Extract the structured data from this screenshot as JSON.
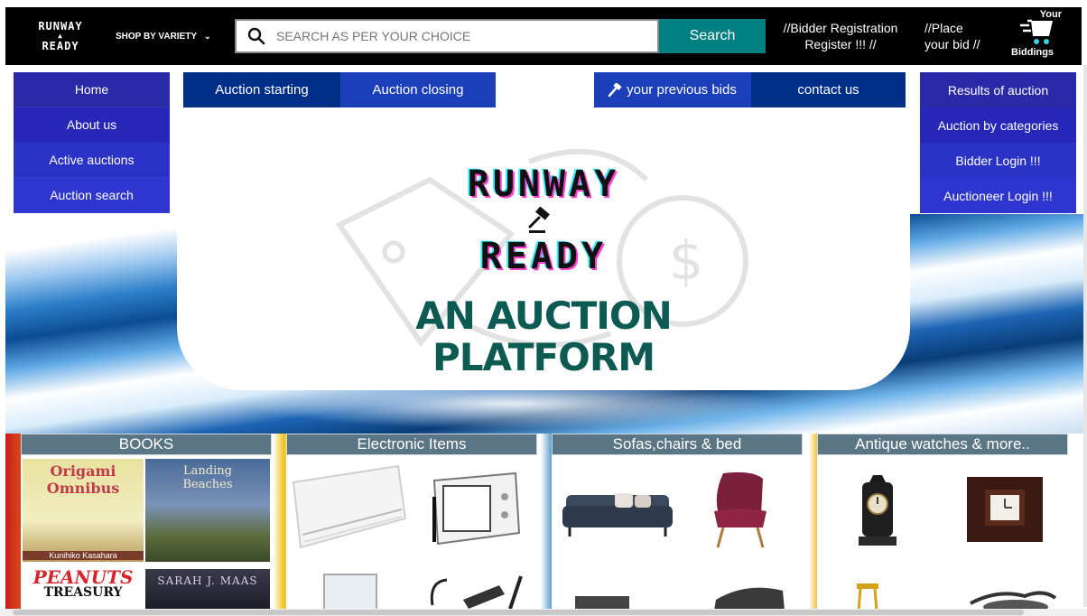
{
  "colors": {
    "topbar_bg": "#000000",
    "search_btn": "#008080",
    "nav_tab_dark": "#002f8a",
    "nav_tab_mid": "#1a3fb8",
    "menu_shades": [
      "#2a2aa8",
      "#2626b8",
      "#2a33c5",
      "#2e36cf"
    ],
    "hero_tagline": "#0c5a52",
    "cat_header": "#5a7584"
  },
  "header": {
    "logo_line1": "RUNWAY",
    "logo_line2": "READY",
    "shop_label": "SHOP BY VARIETY",
    "search_placeholder": "SEARCH AS PER YOUR CHOICE",
    "search_button": "Search",
    "bidder_registration_line1": "//Bidder Registration",
    "bidder_registration_line2": "Register !!! //",
    "place_bid_line1": "//Place",
    "place_bid_line2": "your bid //",
    "cart_top": "Your",
    "cart_bottom": "Biddings"
  },
  "left_menu": [
    "Home",
    "About us",
    "Active auctions",
    "Auction search"
  ],
  "right_menu": [
    "Results of auction",
    "Auction by categories",
    "Bidder Login !!!",
    "Auctioneer Login !!!"
  ],
  "nav_tabs": {
    "auction_starting": "Auction starting",
    "auction_closing": "Auction closing",
    "previous_bids": "your previous bids",
    "contact": "contact us"
  },
  "hero": {
    "title_line1": "RUNWAY",
    "title_line2": "READY",
    "tagline_line1": "AN AUCTION",
    "tagline_line2": "PLATFORM"
  },
  "categories": [
    {
      "title": "BOOKS"
    },
    {
      "title": "Electronic Items"
    },
    {
      "title": "Sofas,chairs & bed"
    },
    {
      "title": "Antique watches & more.."
    }
  ],
  "books": {
    "book1_title1": "Origami",
    "book1_title2": "Omnibus",
    "book1_author": "Kunihiko Kasahara",
    "book2_title1": "Landing",
    "book2_title2": "Beaches",
    "book3_title1": "PEANUTS",
    "book3_title2": "TREASURY",
    "book4_author": "SARAH J. MAAS"
  }
}
